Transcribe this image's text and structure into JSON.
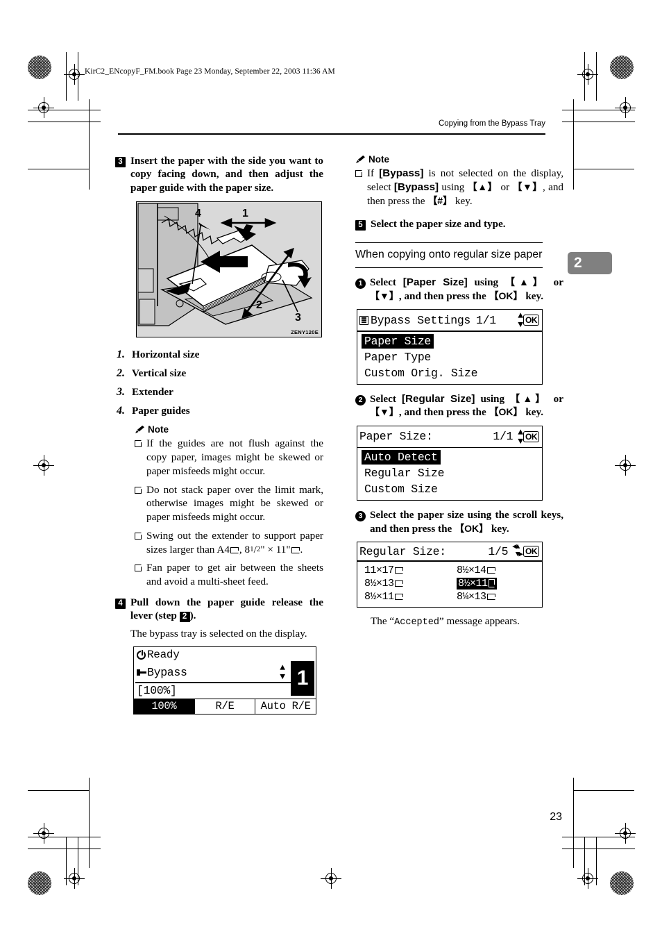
{
  "print_marks": {
    "figure_code": "ZENY120E"
  },
  "file_header": "KirC2_ENcopyF_FM.book  Page 23  Monday, September 22, 2003  11:36 AM",
  "running_header": "Copying from the Bypass Tray",
  "chapter_tab": "2",
  "page_number": "23",
  "left_column": {
    "step3": {
      "number": "3",
      "text": "Insert the paper with the side you want to copy facing down, and then adjust the paper guide with the paper size."
    },
    "figure": {
      "callouts": [
        "1",
        "2",
        "3",
        "4"
      ],
      "code": "ZENY120E"
    },
    "numbered_list": [
      {
        "n": "1.",
        "t": "Horizontal size"
      },
      {
        "n": "2.",
        "t": "Vertical size"
      },
      {
        "n": "3.",
        "t": "Extender"
      },
      {
        "n": "4.",
        "t": "Paper guides"
      }
    ],
    "note": {
      "label": "Note",
      "items": [
        "If the guides are not flush against the copy paper, images might be skewed or paper misfeeds might occur.",
        "Do not stack paper over the limit mark, otherwise images might be skewed or paper misfeeds might occur.",
        "Fan paper to get air between the sheets and avoid a multi-sheet feed."
      ],
      "extender_item": {
        "prefix": "Swing out the extender to support paper sizes larger than A4",
        "mid": ", 8",
        "frac_num": "1",
        "frac_den": "2",
        "after_frac": "\" × 11\"",
        "suffix": "."
      }
    },
    "step4": {
      "number": "4",
      "text_before": "Pull down the paper guide release the lever (step ",
      "inline_step": "2",
      "text_after": ").",
      "body": "The bypass tray is selected on the display."
    },
    "status_lcd": {
      "ready": "Ready",
      "tray": "Bypass",
      "zoom": "[100%]",
      "big_number": "1",
      "tabs": [
        "100%",
        "R/E",
        "Auto R/E"
      ]
    }
  },
  "right_column": {
    "note": {
      "label": "Note",
      "item_parts": {
        "a": "If ",
        "bypass1": "[Bypass]",
        "b": " is not selected on the display, select ",
        "bypass2": "[Bypass]",
        "c": " using ",
        "up": "{▲}",
        "d": " or ",
        "down": "{▼}",
        "e": ", and then press the ",
        "hash": "{#}",
        "f": " key."
      }
    },
    "step5": {
      "number": "5",
      "text": "Select the paper size and type."
    },
    "subsection": {
      "title": "When copying onto regular size paper"
    },
    "substeps": [
      {
        "num": "1",
        "parts": {
          "a": "Select ",
          "b": "[Paper Size]",
          "c": " using ",
          "up": "{▲}",
          "d": " or ",
          "down": "{▼}",
          "e": ", and then press the ",
          "ok": "{OK}",
          "f": " key."
        }
      },
      {
        "num": "2",
        "parts": {
          "a": "Select ",
          "b": "[Regular Size]",
          "c": " using ",
          "up": "{▲}",
          "d": " or ",
          "down": "{▼}",
          "e": ", and then press the ",
          "ok": "{OK}",
          "f": " key."
        }
      },
      {
        "num": "3",
        "parts": {
          "a": "Select the paper size using the scroll keys, and then press the ",
          "ok": "{OK}",
          "f": " key."
        }
      }
    ],
    "lcd_bypass_settings": {
      "title": "Bypass Settings",
      "page": "1/1",
      "ok": "OK",
      "items": [
        "Paper Size",
        "Paper Type",
        "Custom Orig. Size"
      ],
      "selected_index": 0
    },
    "lcd_paper_size": {
      "title": "Paper Size:",
      "page": "1/1",
      "ok": "OK",
      "items": [
        "Auto Detect",
        "Regular Size",
        "Custom Size"
      ],
      "selected_index": 0
    },
    "lcd_regular_size": {
      "title": "Regular Size:",
      "page": "1/5",
      "ok": "OK",
      "cells": [
        {
          "label": "11×17",
          "orient": "land",
          "selected": false
        },
        {
          "label": "8½×14",
          "orient": "land",
          "selected": false
        },
        {
          "label": "8½×13",
          "orient": "land",
          "selected": false
        },
        {
          "label": "8½×11",
          "orient": "port",
          "selected": true
        },
        {
          "label": "8½×11",
          "orient": "land",
          "selected": false
        },
        {
          "label": "8¼×13",
          "orient": "land",
          "selected": false
        }
      ]
    },
    "accepted_note": {
      "before": "The “",
      "mono": "Accepted",
      "after": "” message appears."
    }
  }
}
